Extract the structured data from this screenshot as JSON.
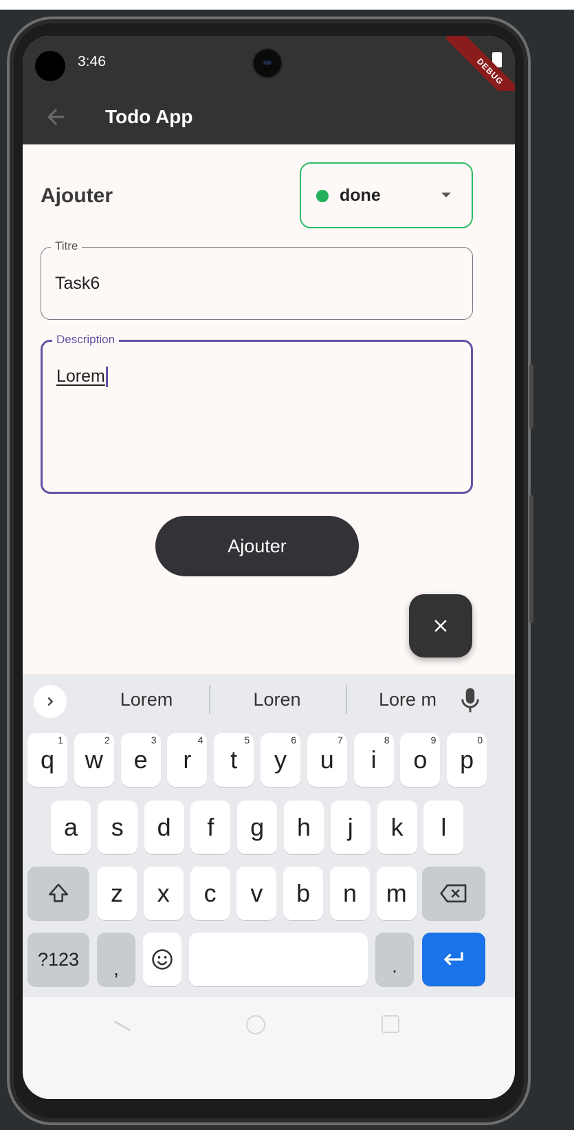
{
  "status_bar": {
    "time": "3:46",
    "debug_label": "DEBUG"
  },
  "app_bar": {
    "title": "Todo App"
  },
  "form": {
    "section_title": "Ajouter",
    "status_value": "done",
    "title_field": {
      "label": "Titre",
      "value": "Task6"
    },
    "description_field": {
      "label": "Description",
      "value": "Lorem"
    },
    "submit_label": "Ajouter"
  },
  "keyboard": {
    "suggestions": [
      "Lorem",
      "Loren",
      "Lore m"
    ],
    "row1": [
      {
        "key": "q",
        "hint": "1"
      },
      {
        "key": "w",
        "hint": "2"
      },
      {
        "key": "e",
        "hint": "3"
      },
      {
        "key": "r",
        "hint": "4"
      },
      {
        "key": "t",
        "hint": "5"
      },
      {
        "key": "y",
        "hint": "6"
      },
      {
        "key": "u",
        "hint": "7"
      },
      {
        "key": "i",
        "hint": "8"
      },
      {
        "key": "o",
        "hint": "9"
      },
      {
        "key": "p",
        "hint": "0"
      }
    ],
    "row2": [
      "a",
      "s",
      "d",
      "f",
      "g",
      "h",
      "j",
      "k",
      "l"
    ],
    "row3": [
      "z",
      "x",
      "c",
      "v",
      "b",
      "n",
      "m"
    ],
    "symbols_label": "?123",
    "comma_label": ",",
    "period_label": "."
  },
  "colors": {
    "accent": "#6750a4",
    "status_green": "#22b05a",
    "enter_blue": "#1a73e8",
    "app_bar": "#333333"
  },
  "icons": [
    "back-arrow-icon",
    "close-icon",
    "chevron-right-icon",
    "microphone-icon",
    "shift-icon",
    "backspace-icon",
    "emoji-icon",
    "enter-icon"
  ]
}
